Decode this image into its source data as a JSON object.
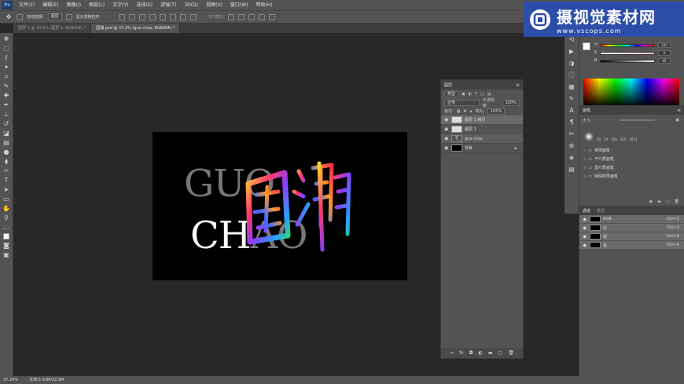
{
  "menu": {
    "items": [
      "文件(F)",
      "编辑(E)",
      "图像(I)",
      "图层(L)",
      "文字(Y)",
      "选择(S)",
      "滤镜(T)",
      "3D(D)",
      "视图(V)",
      "窗口(W)",
      "帮助(H)"
    ],
    "logo": "Ps"
  },
  "options": {
    "auto_select_label": "自动选择:",
    "auto_select_value": "图层",
    "show_transform_label": "显示变换控件",
    "mode_3d_label": "3D 模式:"
  },
  "tabs": [
    {
      "label": "图层 1 @ 33.4% (图层 1, RGB/8#) *"
    },
    {
      "label": "国潮.psd @ 37.2% (guo  chao, RGB/8#) *"
    }
  ],
  "canvas": {
    "line1": "GUO",
    "line2_bright": "CH",
    "line2_dim": "AO",
    "art_text": "国潮"
  },
  "layers_panel": {
    "title": "图层",
    "filter_kind": "类型",
    "blend_mode": "正常",
    "opacity_label": "不透明度:",
    "opacity_value": "100%",
    "lock_label": "锁定:",
    "fill_label": "填充:",
    "fill_value": "100%",
    "layers": [
      {
        "name": "图层 1 拷贝"
      },
      {
        "name": "图层 1"
      },
      {
        "name": "guo  chao"
      },
      {
        "name": "背景"
      }
    ]
  },
  "color_panel": {
    "h_label": "H",
    "h_value": "320",
    "s_label": "S",
    "s_value": "0",
    "b_label": "B",
    "b_value": "95"
  },
  "brushes_panel": {
    "title": "画笔",
    "size_label": "大小:",
    "presets": [
      "30",
      "50",
      "500",
      "325",
      "2611"
    ],
    "folders": [
      "常规画笔",
      "干介质画笔",
      "湿介质画笔",
      "特殊效果画笔"
    ]
  },
  "channels_panel": {
    "tabs": [
      "通道",
      "路径"
    ],
    "channels": [
      {
        "name": "RGB",
        "shortcut": "Ctrl+2"
      },
      {
        "name": "红",
        "shortcut": "Ctrl+3"
      },
      {
        "name": "绿",
        "shortcut": "Ctrl+4"
      },
      {
        "name": "蓝",
        "shortcut": "Ctrl+5"
      }
    ]
  },
  "status": {
    "zoom": "37.24%",
    "doc": "文档:5.93M/22.9M"
  },
  "watermark": {
    "title": "摄视觉素材网",
    "url": "www.vscops.com"
  },
  "colors": {
    "ui_panel": "#535353",
    "workspace": "#282828",
    "watermark_bg": "#2d4ea8"
  }
}
